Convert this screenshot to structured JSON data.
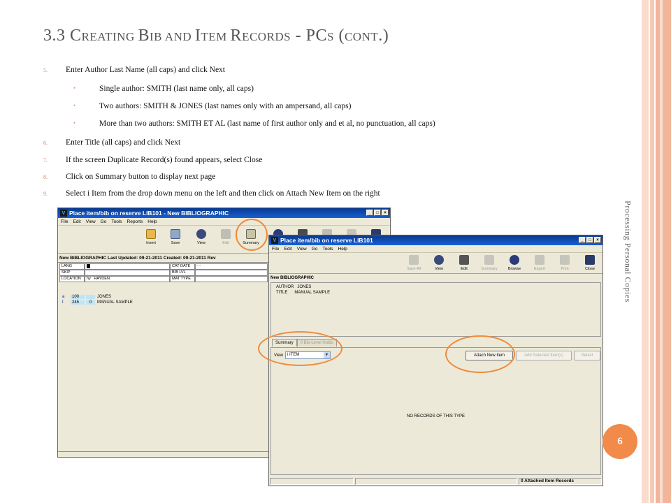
{
  "slide": {
    "title_main": "3.3 C",
    "title_parts": [
      "3.3 ",
      "C",
      "REATING ",
      "B",
      "IB AND ",
      "I",
      "TEM ",
      "R",
      "ECORDS",
      " - PC",
      "S",
      " (",
      "CONT",
      ".)"
    ],
    "title_text": "3.3 Creating Bib and Item Records - PCs (cont.)",
    "side_label": "Processing Personal Copies",
    "page_number": "6",
    "colors": {
      "accent": "#f28a4a",
      "stripe": "#f6c9b4",
      "circle": "#ef8b3c"
    }
  },
  "bullets": [
    {
      "num": "5.",
      "text": "Enter Author Last Name (all caps) and click Next"
    },
    {
      "sub": true,
      "text": "Single author: SMITH (last name only, all caps)"
    },
    {
      "sub": true,
      "text": "Two authors: SMITH  & JONES (last names only with an ampersand, all caps)"
    },
    {
      "sub": true,
      "text": "More than two authors: SMITH ET AL (last name of first author only and et al, no punctuation, all caps)"
    },
    {
      "num": "6.",
      "text": "Enter Title (all caps) and click Next"
    },
    {
      "num": "7.",
      "text": "If the screen Duplicate Record(s) found appears, select Close"
    },
    {
      "num": "8.",
      "text": "Click on Summary button to display next page"
    },
    {
      "num": "9.",
      "text": "Select i Item from the drop down menu on the left and then click on Attach New Item on the right"
    }
  ],
  "window1": {
    "title": "Place item/bib on reserve LIB101 - New BIBLIOGRAPHIC",
    "menu": [
      "File",
      "Edit",
      "View",
      "Go",
      "Tools",
      "Reports",
      "Help"
    ],
    "tools": [
      "Insert",
      "Save",
      "View",
      "Edit",
      "Summary"
    ],
    "record_header": "New BIBLIOGRAPHIC     Last Updated: 09-21-2011     Created: 09-21-2011     Rev",
    "fields": {
      "lang": "LANG",
      "skip": "SKIP",
      "location": "LOCATION",
      "location_code": "hy",
      "location_value": "HAYDEN",
      "cat_date": "CAT DATE",
      "cat_date_value": "- -",
      "bib_lvl": "BIB LVL",
      "mat_type": "MAT TYPE"
    },
    "marc": [
      {
        "tag": "a",
        "num": "100",
        "ind": "",
        "value": "JONES"
      },
      {
        "tag": "t",
        "num": "245",
        "ind": "0",
        "value": "MANUAL SAMPLE"
      }
    ]
  },
  "window2": {
    "title": "Place item/bib on reserve LIB101",
    "menu": [
      "File",
      "Edit",
      "View",
      "Go",
      "Tools",
      "Help"
    ],
    "tools": [
      {
        "label": "Save All",
        "disabled": true
      },
      {
        "label": "View",
        "disabled": false
      },
      {
        "label": "Edit",
        "disabled": false
      },
      {
        "label": "Summary",
        "disabled": true
      },
      {
        "label": "Browse",
        "disabled": false
      },
      {
        "label": "Export",
        "disabled": true
      },
      {
        "label": "Print",
        "disabled": true
      },
      {
        "label": "Close",
        "disabled": false
      }
    ],
    "record_header": "New BIBLIOGRAPHIC",
    "author_label": "AUTHOR",
    "author_value": "JONES",
    "title_label": "TITLE",
    "title_value": "MANUAL SAMPLE",
    "tabs": [
      "Summary",
      "0 Bib-Level Holds"
    ],
    "view_label": "View",
    "view_value": "i ITEM",
    "buttons": {
      "attach_new": "Attach New Item",
      "add_selected": "Add Selected Item(s)",
      "select": "Select"
    },
    "empty_message": "NO RECORDS OF THIS TYPE",
    "status": "0 Attached Item Records"
  }
}
